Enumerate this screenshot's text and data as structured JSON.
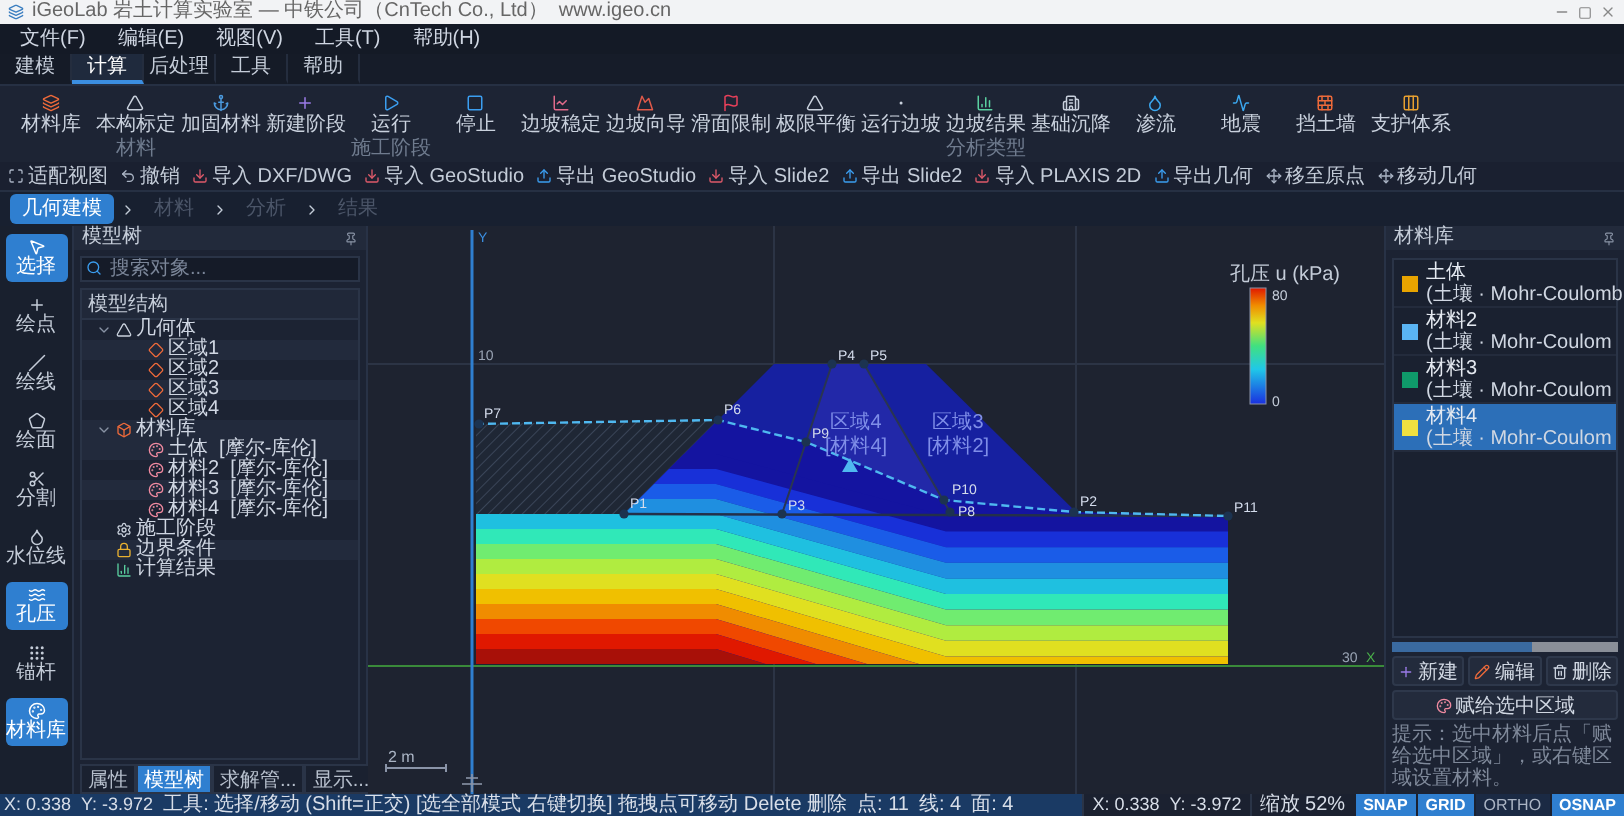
{
  "window": {
    "title": "iGeoLab 岩土计算实验室 — 中铁公司（CnTech Co., Ltd）  www.igeo.cn"
  },
  "menu": [
    "文件(F)",
    "编辑(E)",
    "视图(V)",
    "工具(T)",
    "帮助(H)"
  ],
  "tabs": [
    {
      "label": "建模",
      "selected": false
    },
    {
      "label": "计算",
      "selected": true
    },
    {
      "label": "后处理",
      "selected": false
    },
    {
      "label": "工具",
      "selected": false
    },
    {
      "label": "帮助",
      "selected": false
    }
  ],
  "ribbon": [
    {
      "label": "材料库"
    },
    {
      "label": "本构标定",
      "caption": "材料"
    },
    {
      "label": "加固材料"
    },
    {
      "label": "新建阶段"
    },
    {
      "label": "运行",
      "caption": "施工阶段"
    },
    {
      "label": "停止"
    },
    {
      "label": "边坡稳定"
    },
    {
      "label": "边坡向导"
    },
    {
      "label": "滑面限制"
    },
    {
      "label": "极限平衡"
    },
    {
      "label": "运行边坡"
    },
    {
      "label": "边坡结果",
      "caption": "分析类型"
    },
    {
      "label": "基础沉降"
    },
    {
      "label": "渗流"
    },
    {
      "label": "地震"
    },
    {
      "label": "挡土墙"
    },
    {
      "label": "支护体系"
    }
  ],
  "quick_toolbar": [
    "适配视图",
    "撤销",
    "导入 DXF/DWG",
    "导入 GeoStudio",
    "导出 GeoStudio",
    "导入 Slide2",
    "导出 Slide2",
    "导入 PLAXIS 2D",
    "导出几何",
    "移至原点",
    "移动几何"
  ],
  "workflow": [
    {
      "label": "几何建模",
      "selected": true
    },
    {
      "label": "材料",
      "selected": false
    },
    {
      "label": "分析",
      "selected": false
    },
    {
      "label": "结果",
      "selected": false
    }
  ],
  "tools": [
    {
      "label": "选择",
      "selected": true
    },
    {
      "label": "绘点",
      "selected": false
    },
    {
      "label": "绘线",
      "selected": false
    },
    {
      "label": "绘面",
      "selected": false
    },
    {
      "label": "分割",
      "selected": false
    },
    {
      "label": "水位线",
      "selected": false
    },
    {
      "label": "孔压",
      "selected": true
    },
    {
      "label": "锚杆",
      "selected": false
    },
    {
      "label": "材料库",
      "selected": true
    }
  ],
  "model_tree": {
    "title": "模型树",
    "search": {
      "placeholder": "搜索对象..."
    },
    "section": "模型结构",
    "items": [
      {
        "label": "几何体",
        "kind": "geometry",
        "expanded": true,
        "children": [
          {
            "label": "区域1",
            "kind": "region"
          },
          {
            "label": "区域2",
            "kind": "region"
          },
          {
            "label": "区域3",
            "kind": "region"
          },
          {
            "label": "区域4",
            "kind": "region"
          }
        ]
      },
      {
        "label": "材料库",
        "kind": "library",
        "expanded": true,
        "children": [
          {
            "label": "土体  [摩尔-库伦]",
            "kind": "material"
          },
          {
            "label": "材料2  [摩尔-库伦]",
            "kind": "material"
          },
          {
            "label": "材料3  [摩尔-库伦]",
            "kind": "material"
          },
          {
            "label": "材料4  [摩尔-库伦]",
            "kind": "material"
          }
        ]
      },
      {
        "label": "施工阶段",
        "kind": "stage"
      },
      {
        "label": "边界条件",
        "kind": "boundary"
      },
      {
        "label": "计算结果",
        "kind": "results"
      }
    ]
  },
  "panel_tabs": [
    {
      "label": "属性",
      "selected": false
    },
    {
      "label": "模型树",
      "selected": true
    },
    {
      "label": "求解管...",
      "selected": false
    },
    {
      "label": "显示...",
      "selected": false
    }
  ],
  "canvas": {
    "y_axis": "Y",
    "x_axis": "X",
    "ticks": [
      "10",
      "30"
    ],
    "points": [
      "P7",
      "P1",
      "P6",
      "P3",
      "P9",
      "P4",
      "P5",
      "P10",
      "P8",
      "P2",
      "P11"
    ],
    "regions": [
      {
        "name": "区域4",
        "material": "[材料4]"
      },
      {
        "name": "区域3",
        "material": "[材料2]"
      }
    ],
    "legend": {
      "title": "孔压 u (kPa)",
      "max": "80",
      "min": "0"
    },
    "scale": "2 m"
  },
  "materials": {
    "title": "材料库",
    "items": [
      {
        "name": "土体",
        "type": "(土壤 · Mohr-Coulomb",
        "color": "#e8a400",
        "selected": false
      },
      {
        "name": "材料2",
        "type": "(土壤 · Mohr-Coulom",
        "color": "#5ab4f2",
        "selected": false
      },
      {
        "name": "材料3",
        "type": "(土壤 · Mohr-Coulom",
        "color": "#0f9a6a",
        "selected": false
      },
      {
        "name": "材料4",
        "type": "(土壤 · Mohr-Coulom",
        "color": "#f0e040",
        "selected": true
      }
    ],
    "actions": [
      "新建",
      "编辑",
      "删除"
    ],
    "assign": "赋给选中区域",
    "hint": "提示：选中材料后点「赋给选中区域」，或右键区域设置材料。"
  },
  "status_bar": {
    "x": "X: 0.338",
    "y": "Y: -3.972",
    "tool_hint": "工具: 选择/移动 (Shift=正交) [选全部模式 右键切换] 拖拽点可移动 Delete 删除",
    "counts": [
      "点: 11",
      "线: 4",
      "面: 4"
    ],
    "cursor_x": "X: 0.338",
    "cursor_y": "Y: -3.972",
    "zoom": "缩放 52%",
    "toggles": [
      {
        "label": "SNAP",
        "on": true
      },
      {
        "label": "GRID",
        "on": true
      },
      {
        "label": "ORTHO",
        "on": false
      },
      {
        "label": "OSNAP",
        "on": true
      }
    ]
  }
}
